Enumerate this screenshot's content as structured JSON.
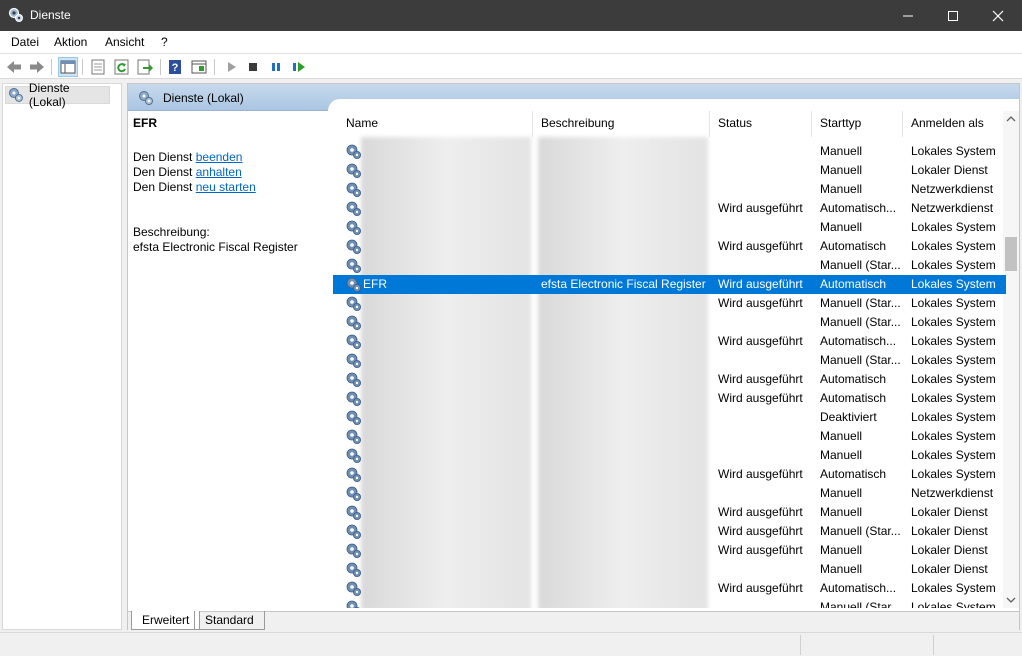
{
  "window": {
    "title": "Dienste"
  },
  "menu": {
    "items": [
      "Datei",
      "Aktion",
      "Ansicht",
      "?"
    ]
  },
  "toolbar": {
    "icons": [
      "back-arrow-icon",
      "forward-arrow-icon",
      "show-hide-console-tree-icon",
      "properties-icon",
      "refresh-icon",
      "export-list-icon",
      "help-icon",
      "extended-view-icon",
      "start-service-icon",
      "stop-service-icon",
      "pause-service-icon",
      "restart-service-icon"
    ]
  },
  "tree": {
    "root_label": "Dienste (Lokal)"
  },
  "panel": {
    "header_title": "Dienste (Lokal)"
  },
  "detail": {
    "service_name": "EFR",
    "action_prefix": "Den Dienst",
    "actions": [
      "beenden",
      "anhalten",
      "neu starten"
    ],
    "description_label": "Beschreibung:",
    "description_text": "efsta Electronic Fiscal Register"
  },
  "columns": [
    "Name",
    "Beschreibung",
    "Status",
    "Starttyp",
    "Anmelden als"
  ],
  "rows": [
    {
      "name": "",
      "desc": "",
      "status": "",
      "start": "Manuell",
      "logon": "Lokales System"
    },
    {
      "name": "",
      "desc": "",
      "status": "",
      "start": "Manuell",
      "logon": "Lokaler Dienst"
    },
    {
      "name": "",
      "desc": "",
      "status": "",
      "start": "Manuell",
      "logon": "Netzwerkdienst"
    },
    {
      "name": "",
      "desc": "",
      "status": "Wird ausgeführt",
      "start": "Automatisch...",
      "logon": "Netzwerkdienst"
    },
    {
      "name": "",
      "desc": "",
      "status": "",
      "start": "Manuell",
      "logon": "Lokales System"
    },
    {
      "name": "",
      "desc": "",
      "status": "Wird ausgeführt",
      "start": "Automatisch",
      "logon": "Lokales System"
    },
    {
      "name": "",
      "desc": "",
      "status": "",
      "start": "Manuell (Star...",
      "logon": "Lokales System"
    },
    {
      "name": "EFR",
      "desc": "efsta Electronic Fiscal Register",
      "status": "Wird ausgeführt",
      "start": "Automatisch",
      "logon": "Lokales System",
      "selected": true
    },
    {
      "name": "",
      "desc": "",
      "status": "Wird ausgeführt",
      "start": "Manuell (Star...",
      "logon": "Lokales System"
    },
    {
      "name": "",
      "desc": "",
      "status": "",
      "start": "Manuell (Star...",
      "logon": "Lokales System"
    },
    {
      "name": "",
      "desc": "",
      "status": "Wird ausgeführt",
      "start": "Automatisch...",
      "logon": "Lokales System"
    },
    {
      "name": "",
      "desc": "",
      "status": "",
      "start": "Manuell (Star...",
      "logon": "Lokales System"
    },
    {
      "name": "",
      "desc": "",
      "status": "Wird ausgeführt",
      "start": "Automatisch",
      "logon": "Lokales System"
    },
    {
      "name": "",
      "desc": "",
      "status": "Wird ausgeführt",
      "start": "Automatisch",
      "logon": "Lokales System"
    },
    {
      "name": "",
      "desc": "",
      "status": "",
      "start": "Deaktiviert",
      "logon": "Lokales System"
    },
    {
      "name": "",
      "desc": "",
      "status": "",
      "start": "Manuell",
      "logon": "Lokales System"
    },
    {
      "name": "",
      "desc": "",
      "status": "",
      "start": "Manuell",
      "logon": "Lokales System"
    },
    {
      "name": "",
      "desc": "",
      "status": "Wird ausgeführt",
      "start": "Automatisch",
      "logon": "Lokales System"
    },
    {
      "name": "",
      "desc": "",
      "status": "",
      "start": "Manuell",
      "logon": "Netzwerkdienst"
    },
    {
      "name": "",
      "desc": "",
      "status": "Wird ausgeführt",
      "start": "Manuell",
      "logon": "Lokaler Dienst"
    },
    {
      "name": "",
      "desc": "",
      "status": "Wird ausgeführt",
      "start": "Manuell (Star...",
      "logon": "Lokaler Dienst"
    },
    {
      "name": "",
      "desc": "",
      "status": "Wird ausgeführt",
      "start": "Manuell",
      "logon": "Lokaler Dienst"
    },
    {
      "name": "",
      "desc": "",
      "status": "",
      "start": "Manuell",
      "logon": "Lokaler Dienst"
    },
    {
      "name": "",
      "desc": "",
      "status": "Wird ausgeführt",
      "start": "Automatisch...",
      "logon": "Lokales System"
    },
    {
      "name": "",
      "desc": "",
      "status": "",
      "start": "Manuell (Star...",
      "logon": "Lokales System"
    }
  ],
  "tabs": [
    "Erweitert",
    "Standard"
  ],
  "colors": {
    "selection": "#0078d7",
    "link": "#0066cc",
    "titlebar": "#3c3c3c"
  }
}
